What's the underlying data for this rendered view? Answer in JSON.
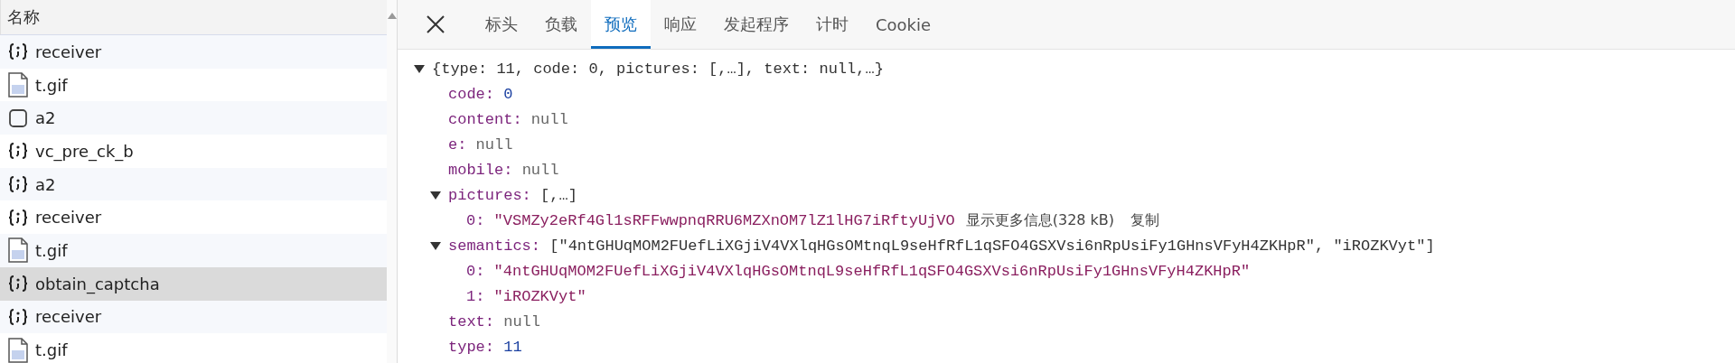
{
  "requests": {
    "header": "名称",
    "items": [
      {
        "kind": "script",
        "name": "receiver",
        "selected": false
      },
      {
        "kind": "image",
        "name": "t.gif",
        "selected": false
      },
      {
        "kind": "blank",
        "name": "a2",
        "selected": false
      },
      {
        "kind": "script",
        "name": "vc_pre_ck_b",
        "selected": false
      },
      {
        "kind": "script",
        "name": "a2",
        "selected": false
      },
      {
        "kind": "script",
        "name": "receiver",
        "selected": false
      },
      {
        "kind": "image",
        "name": "t.gif",
        "selected": false
      },
      {
        "kind": "script",
        "name": "obtain_captcha",
        "selected": true
      },
      {
        "kind": "script",
        "name": "receiver",
        "selected": false
      },
      {
        "kind": "image",
        "name": "t.gif",
        "selected": false
      }
    ]
  },
  "detail": {
    "tabs": [
      {
        "label": "标头",
        "selected": false
      },
      {
        "label": "负载",
        "selected": false
      },
      {
        "label": "预览",
        "selected": true
      },
      {
        "label": "响应",
        "selected": false
      },
      {
        "label": "发起程序",
        "selected": false
      },
      {
        "label": "计时",
        "selected": false
      },
      {
        "label": "Cookie",
        "selected": false
      }
    ],
    "preview": {
      "summary": "{type: 11, code: 0, pictures: [,…], text: null,…}",
      "expanded": true,
      "properties": [
        {
          "kind": "number",
          "key": "code:",
          "value": "0"
        },
        {
          "kind": "null",
          "key": "content:",
          "value": "null"
        },
        {
          "kind": "null",
          "key": "e:",
          "value": "null"
        },
        {
          "kind": "null",
          "key": "mobile:",
          "value": "null"
        },
        {
          "kind": "array",
          "key": "pictures:",
          "summary": "[,…]",
          "expanded": true,
          "children": [
            {
              "key": "0:",
              "value": "\"VSMZy2eRf4Gl1sRFFwwpnqRRU6MZXnOM7lZ1lHG7iRftyUjVO",
              "more": "显示更多信息(328 kB)",
              "copy": "复制"
            }
          ]
        },
        {
          "kind": "array",
          "key": "semantics:",
          "summary": "[\"4ntGHUqMOM2FUefLiXGjiV4VXlqHGsOMtnqL9seHfRfL1qSFO4GSXVsi6nRpUsiFy1GHnsVFyH4ZKHpR\", \"iROZKVyt\"]",
          "expanded": true,
          "children": [
            {
              "key": "0:",
              "value": "\"4ntGHUqMOM2FUefLiXGjiV4VXlqHGsOMtnqL9seHfRfL1qSFO4GSXVsi6nRpUsiFy1GHnsVFyH4ZKHpR\""
            },
            {
              "key": "1:",
              "value": "\"iROZKVyt\""
            }
          ]
        },
        {
          "kind": "null",
          "key": "text:",
          "value": "null"
        },
        {
          "kind": "number",
          "key": "type:",
          "value": "11"
        }
      ]
    }
  }
}
